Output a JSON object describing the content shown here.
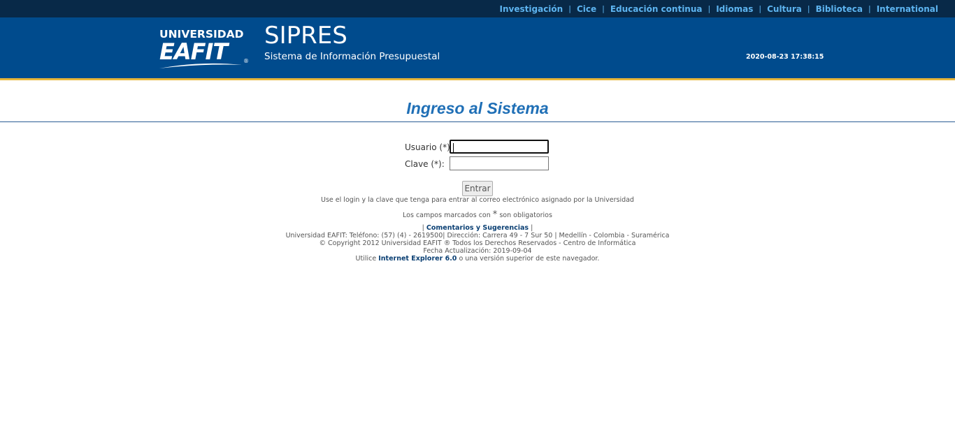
{
  "topnav": {
    "links": [
      "Investigación",
      "Cice",
      "Educación continua",
      "Idiomas",
      "Cultura",
      "Biblioteca",
      "International"
    ],
    "separator": "|"
  },
  "header": {
    "logo_line1": "UNIVERSIDAD",
    "logo_line2": "EAFIT",
    "logo_reg": "®",
    "app_name": "SIPRES",
    "app_subtitle": "Sistema de Información Presupuestal",
    "datetime": "2020-08-23 17:38:15"
  },
  "login": {
    "title": "Ingreso al Sistema",
    "user_label": "Usuario (*):",
    "user_value": "",
    "password_label": "Clave (*):",
    "password_value": "",
    "submit_label": "Entrar",
    "hint": "Use el login y la clave que tenga para entrar al correo electrónico asignado por la Universidad",
    "required_note_pre": "Los campos marcados con",
    "required_note_star": "*",
    "required_note_post": "son obligatorios"
  },
  "footer": {
    "pipe_left": "|",
    "comments_link": "Comentarios y Sugerencias",
    "pipe_right": "|",
    "contact": "Universidad EAFIT: Teléfono: (57) (4) - 2619500| Dirección: Carrera 49 - 7 Sur 50 | Medellín - Colombia - Suramérica",
    "copyright": "© Copyright 2012 Universidad EAFIT ® Todos los Derechos Reservados - Centro de Informática",
    "updated": "Fecha Actualización: 2019-09-04",
    "browser_pre": "Utilice",
    "browser_link": "Internet Explorer 6.0",
    "browser_post": "o una versión superior de este navegador."
  },
  "colors": {
    "topbar_bg": "#082948",
    "header_bg": "#004b8d",
    "accent_gold": "#e8b63a",
    "title_blue": "#1f6fb6",
    "nav_link": "#5db4f0"
  }
}
